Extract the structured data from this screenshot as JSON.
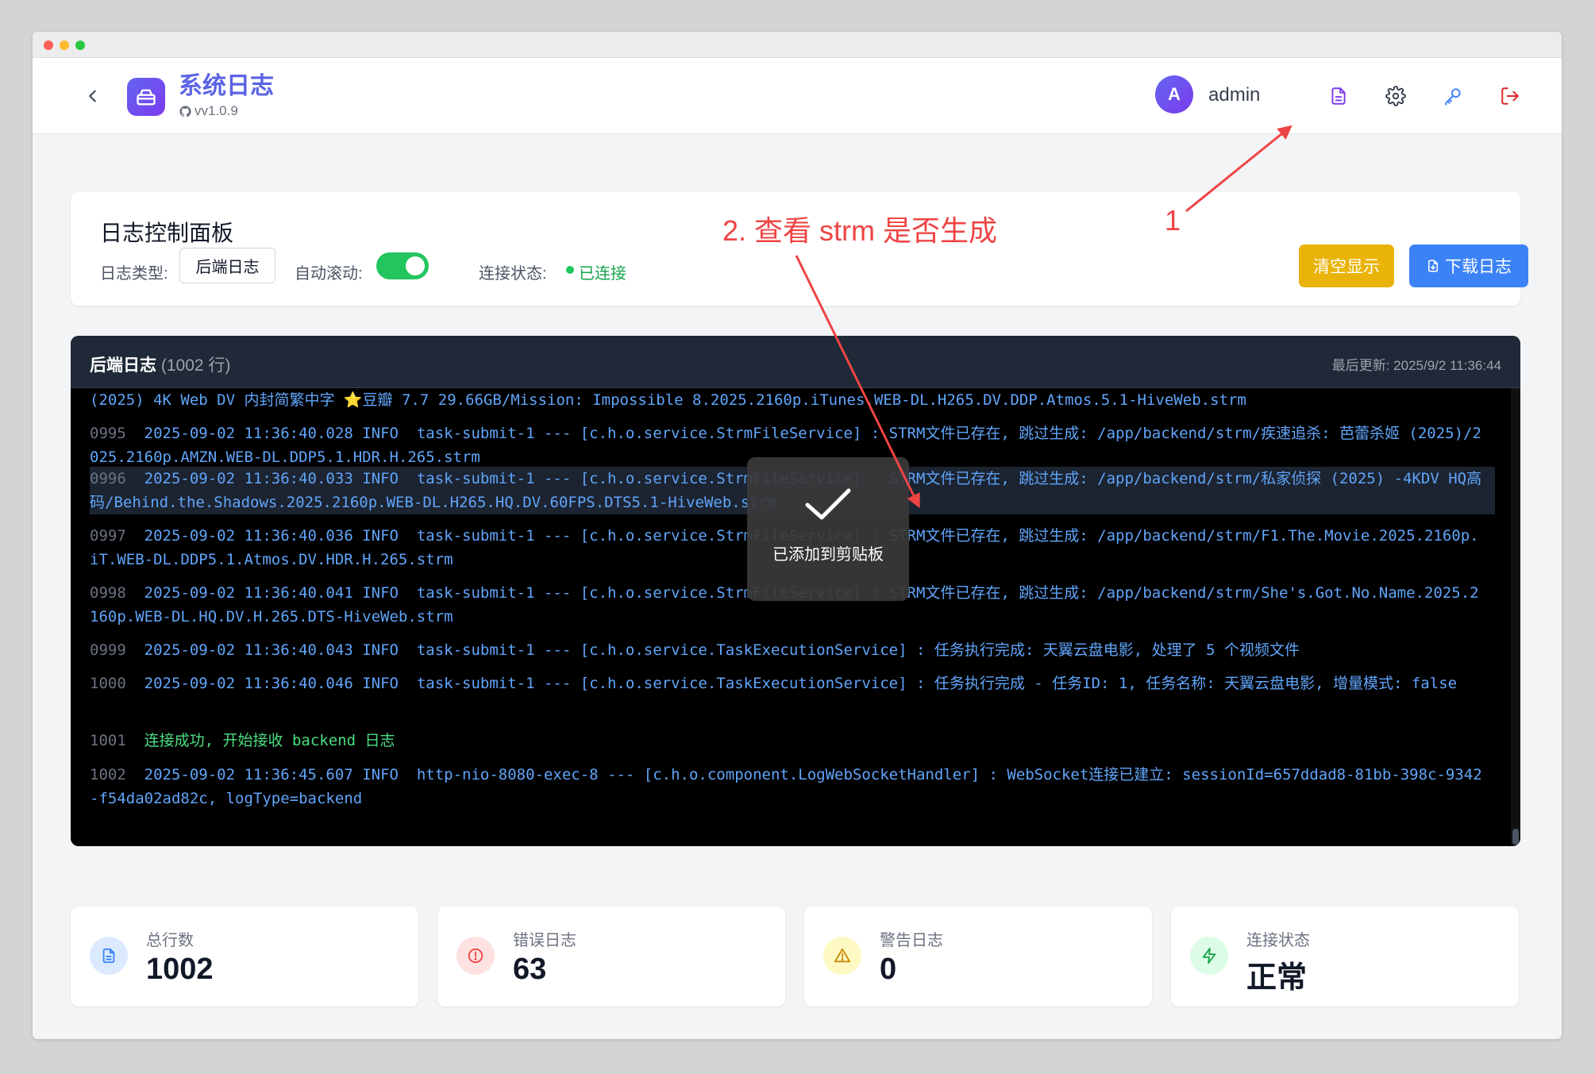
{
  "header": {
    "title": "系统日志",
    "version": "vv1.0.9",
    "avatar_letter": "A",
    "username": "admin",
    "icons": [
      "document-icon",
      "gear-icon",
      "key-icon",
      "logout-icon"
    ]
  },
  "control_panel": {
    "title": "日志控制面板",
    "log_type_label": "日志类型:",
    "log_type_value": "后端日志",
    "auto_scroll_label": "自动滚动:",
    "auto_scroll_on": true,
    "connection_label": "连接状态:",
    "connection_value": "已连接",
    "clear_button": "清空显示",
    "download_button": "下载日志"
  },
  "terminal": {
    "title": "后端日志",
    "line_count": "(1002 行)",
    "last_updated": "最后更新: 2025/9/2 11:36:44",
    "lines": [
      {
        "num": "",
        "text": "(2025) 4K Web DV 内封简繁中字 ⭐豆瓣 7.7 29.66GB/Mission: Impossible 8.2025.2160p.iTunes.WEB-DL.H265.DV.DDP.Atmos.5.1-HiveWeb.strm"
      },
      {
        "num": "0995",
        "text": "2025-09-02 11:36:40.028 INFO  task-submit-1 --- [c.h.o.service.StrmFileService] : STRM文件已存在, 跳过生成: /app/backend/strm/疾速追杀: 芭蕾杀姬 (2025)/2025.2160p.AMZN.WEB-DL.DDP5.1.HDR.H.265.strm"
      },
      {
        "num": "0996",
        "text": "2025-09-02 11:36:40.033 INFO  task-submit-1 --- [c.h.o.service.StrmFileService] : STRM文件已存在, 跳过生成: /app/backend/strm/私家侦探 (2025) -4KDV HQ高码/Behind.the.Shadows.2025.2160p.WEB-DL.H265.HQ.DV.60FPS.DTS5.1-HiveWeb.strm"
      },
      {
        "num": "0997",
        "text": "2025-09-02 11:36:40.036 INFO  task-submit-1 --- [c.h.o.service.StrmFileService] : STRM文件已存在, 跳过生成: /app/backend/strm/F1.The.Movie.2025.2160p.iT.WEB-DL.DDP5.1.Atmos.DV.HDR.H.265.strm"
      },
      {
        "num": "0998",
        "text": "2025-09-02 11:36:40.041 INFO  task-submit-1 --- [c.h.o.service.StrmFileService] : STRM文件已存在, 跳过生成: /app/backend/strm/She's.Got.No.Name.2025.2160p.WEB-DL.HQ.DV.H.265.DTS-HiveWeb.strm"
      },
      {
        "num": "0999",
        "text": "2025-09-02 11:36:40.043 INFO  task-submit-1 --- [c.h.o.service.TaskExecutionService] : 任务执行完成: 天翼云盘电影, 处理了 5 个视频文件"
      },
      {
        "num": "1000",
        "text": "2025-09-02 11:36:40.046 INFO  task-submit-1 --- [c.h.o.service.TaskExecutionService] : 任务执行完成 - 任务ID: 1, 任务名称: 天翼云盘电影, 增量模式: false"
      },
      {
        "num": "1001",
        "text": "连接成功, 开始接收 backend 日志"
      },
      {
        "num": "1002",
        "text": "2025-09-02 11:36:45.607 INFO  http-nio-8080-exec-8 --- [c.h.o.component.LogWebSocketHandler] : WebSocket连接已建立: sessionId=657ddad8-81bb-398c-9342-f54da02ad82c, logType=backend"
      }
    ]
  },
  "toast": {
    "message": "已添加到剪贴板"
  },
  "stats": [
    {
      "label": "总行数",
      "value": "1002",
      "icon": "document-icon",
      "color": "#3b82f6"
    },
    {
      "label": "错误日志",
      "value": "63",
      "icon": "alert-circle-icon",
      "color": "#ef4444"
    },
    {
      "label": "警告日志",
      "value": "0",
      "icon": "warning-triangle-icon",
      "color": "#eab308"
    },
    {
      "label": "连接状态",
      "value": "正常",
      "icon": "lightning-icon",
      "color": "#22c55e"
    }
  ],
  "annotations": {
    "step1": "1",
    "step2": "2. 查看 strm 是否生成",
    "color": "#ef4444"
  }
}
